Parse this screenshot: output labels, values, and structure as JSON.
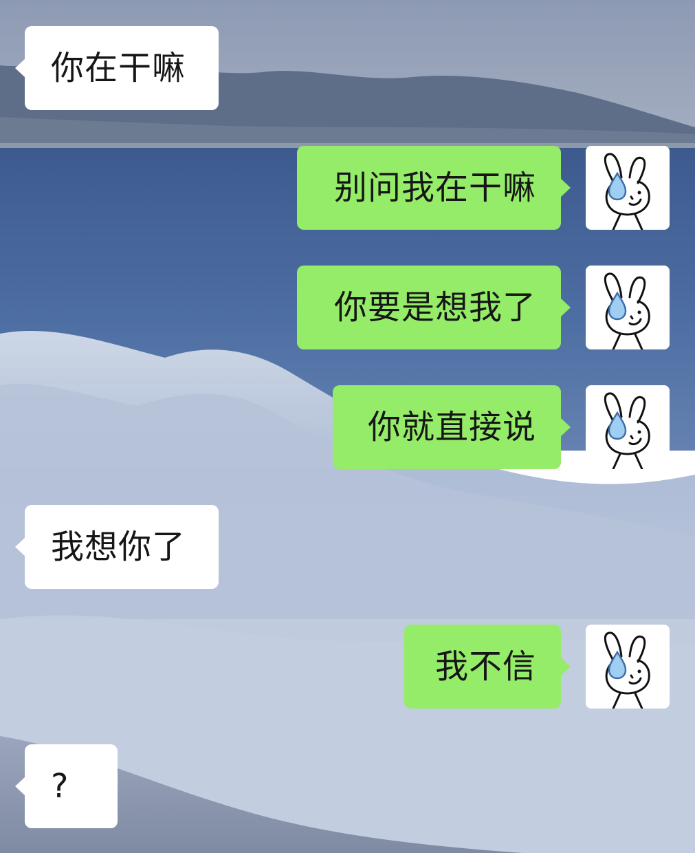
{
  "colors": {
    "incoming_bubble": "#ffffff",
    "outgoing_bubble": "#95ec69",
    "text": "#161616",
    "sea": "#4a6596",
    "sky": "#9aa6bc"
  },
  "avatar": {
    "icon": "bunny-sweat-drop-icon"
  },
  "messages": [
    {
      "side": "in",
      "text": "你在干嘛"
    },
    {
      "side": "out",
      "text": "别问我在干嘛"
    },
    {
      "side": "out",
      "text": "你要是想我了"
    },
    {
      "side": "out",
      "text": "你就直接说"
    },
    {
      "side": "in",
      "text": "我想你了"
    },
    {
      "side": "out",
      "text": "我不信"
    },
    {
      "side": "in",
      "text": "?"
    }
  ]
}
